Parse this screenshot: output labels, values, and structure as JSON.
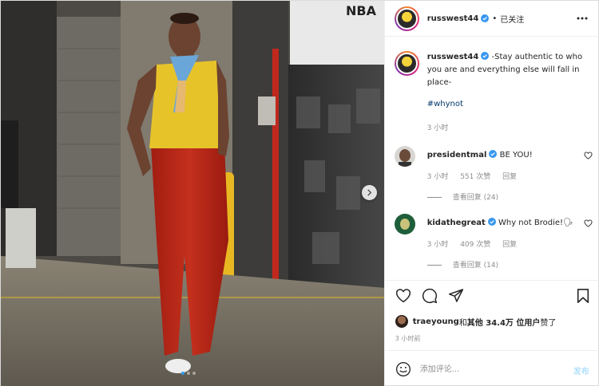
{
  "photo": {
    "alt_sign": "NBA",
    "carousel_total": 3,
    "carousel_active": 1
  },
  "header": {
    "username": "russwest44",
    "separator": "•",
    "follow_state": "已关注",
    "more_icon": "more-horizontal-icon"
  },
  "caption": {
    "username": "russwest44",
    "text": " -Stay authentic to who you are and everything else will fall in place-",
    "hashtag": "#whynot",
    "time": "3 小时"
  },
  "comments": [
    {
      "username": "presidentmal",
      "text": " BE YOU!",
      "time": "3 小时",
      "likes": "551 次赞",
      "reply_label": "回复",
      "view_replies": "查看回复 (24)"
    },
    {
      "username": "kidathegreat",
      "text": " Why not Brodie!🗣",
      "time": "3 小时",
      "likes": "409 次赞",
      "reply_label": "回复",
      "view_replies": "查看回复 (14)"
    }
  ],
  "actions": {
    "icons": [
      "heart-icon",
      "comment-icon",
      "share-icon",
      "bookmark-icon"
    ]
  },
  "likes": {
    "user": "traeyoung",
    "middle": " 和 ",
    "others": "其他 34.4万 位用户",
    "suffix": " 赞了"
  },
  "post_time": "3 小时前",
  "add_comment": {
    "placeholder": "添加评论...",
    "post_label": "发布"
  },
  "colors": {
    "verified": "#3897f0",
    "link": "#00376b",
    "muted": "#8e8e8e",
    "post_disabled": "#b2dffc",
    "carousel_active": "#2d9cf0"
  }
}
